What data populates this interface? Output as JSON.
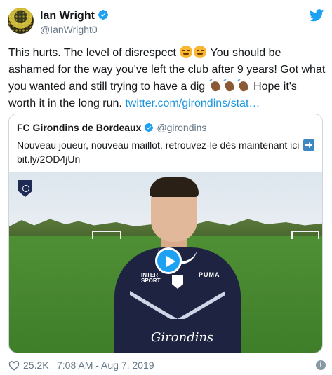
{
  "author": {
    "display_name": "Ian Wright",
    "handle": "@IanWright0",
    "verified": true,
    "avatar_icon": "avatar-image"
  },
  "tweet": {
    "line1_a": "This hurts. The level of disrespect ",
    "line1_b": " You should be",
    "line2": "ashamed for the way you've left the club after 9 years! Got what",
    "line3_a": "you wanted and still trying to have a dig ",
    "line3_b": " Hope it's",
    "line4_a": "worth it in the long run. ",
    "link": "twitter.com/girondins/stat…",
    "emojis": [
      "face-with-steam",
      "face-with-steam",
      "clapping-hands",
      "clapping-hands",
      "clapping-hands"
    ]
  },
  "quoted_tweet": {
    "display_name": "FC Girondins de Bordeaux",
    "handle": "@girondins",
    "verified": true,
    "line1": "Nouveau joueur, nouveau maillot, retrouvez-le dès maintenant ici",
    "line2": "bit.ly/2OD4jUn",
    "emoji": "right-arrow"
  },
  "media": {
    "type": "video",
    "play_icon": "play-icon",
    "shirt_sponsor_1": "INTER",
    "shirt_sponsor_2": "SPORT",
    "shirt_brand": "PUMA",
    "shirt_script": "Gir⁠ondins"
  },
  "footer": {
    "likes": "25.2K",
    "timestamp": "7:08 AM - Aug 7, 2019",
    "info_icon": "i"
  },
  "colors": {
    "link": "#1b95e0",
    "verified": "#1da1f2",
    "muted": "#657786",
    "border": "#ccd6dd"
  }
}
